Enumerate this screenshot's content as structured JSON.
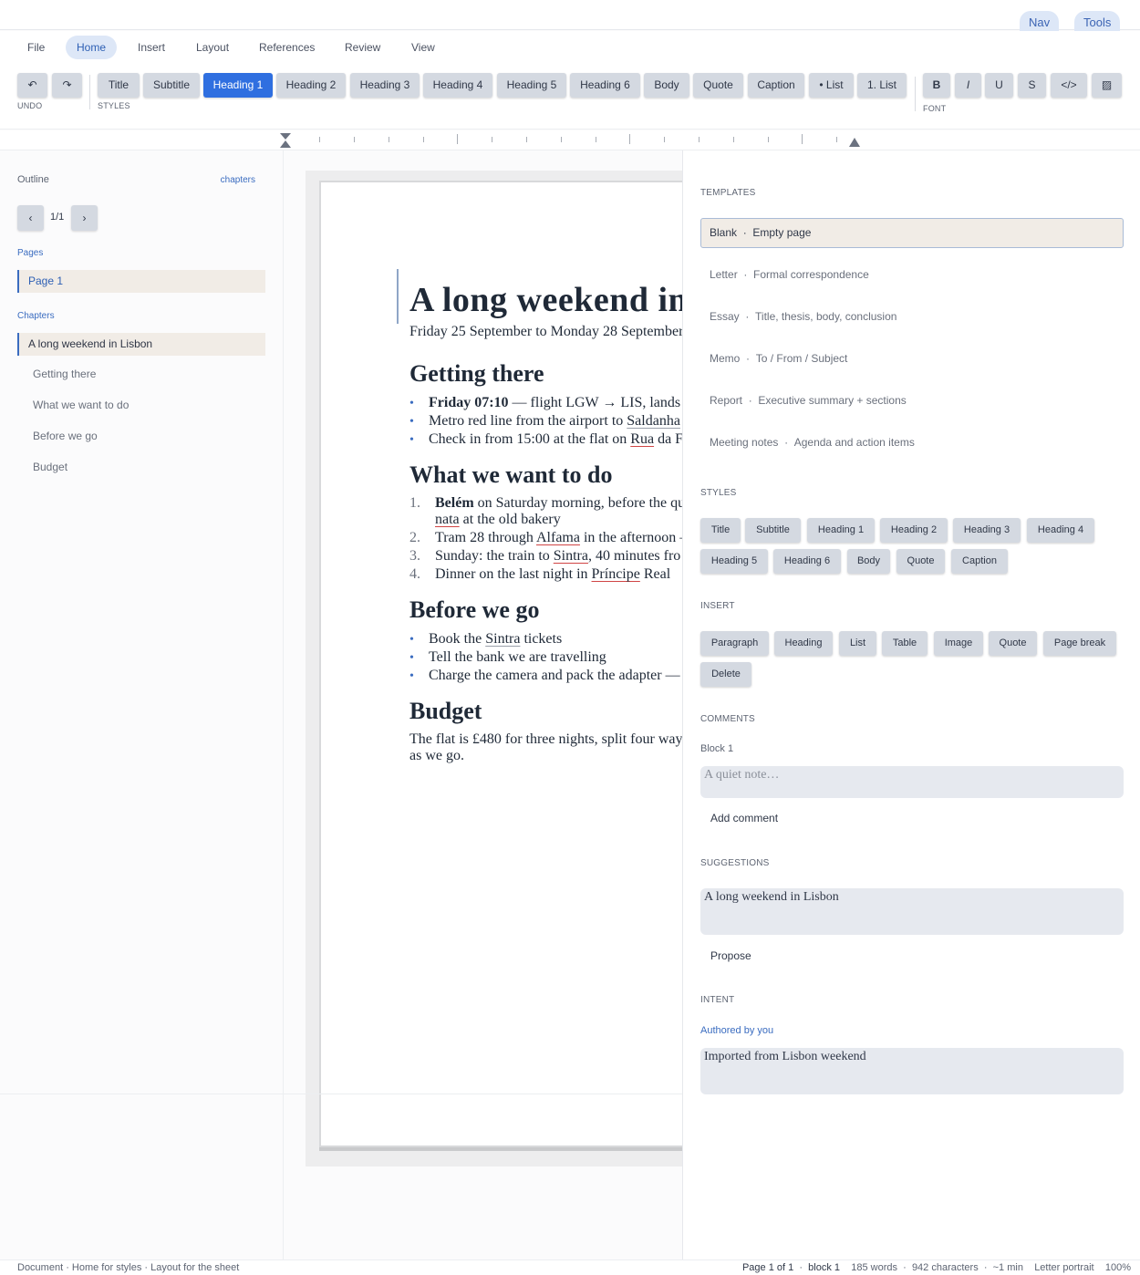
{
  "topbar": {
    "nav_label": "Nav",
    "tools_label": "Tools"
  },
  "menu": {
    "items": [
      "File",
      "Home",
      "Insert",
      "Layout",
      "References",
      "Review",
      "View"
    ],
    "active": "Home"
  },
  "toolbar": {
    "undo_icon": "↶",
    "redo_icon": "↷",
    "undo_group_label": "UNDO",
    "styles_group_label": "STYLES",
    "font_group_label": "FONT",
    "styles": [
      "Title",
      "Subtitle",
      "Heading 1",
      "Heading 2",
      "Heading 3",
      "Heading 4",
      "Heading 5",
      "Heading 6",
      "Body",
      "Quote",
      "Caption",
      "• List",
      "1. List"
    ],
    "active_style": "Heading 1",
    "font_buttons": [
      "B",
      "I",
      "U",
      "S",
      "</>",
      "▨"
    ]
  },
  "sidebar": {
    "title": "Outline",
    "mode_link": "chapters",
    "pager": {
      "prev": "‹",
      "next": "›",
      "label": "1/1"
    },
    "pages_label": "Pages",
    "pages": [
      "Page 1"
    ],
    "chapters_label": "Chapters",
    "chapters": [
      "A long weekend in Lisbon",
      "Getting there",
      "What we want to do",
      "Before we go",
      "Budget"
    ]
  },
  "document": {
    "title": "A long weekend in Lisbon",
    "subtitle": "Friday 25 September to Monday 28 September",
    "sections": {
      "getting_there": {
        "heading": "Getting there",
        "items": [
          {
            "bold": "Friday 07:10",
            "text": " — flight LGW → LIS, lands"
          },
          {
            "text": "Metro red line from the airport to ",
            "link": "Saldanha"
          },
          {
            "text": "Check in from 15:00 at the flat on ",
            "link": "Rua",
            "rest": " da F"
          }
        ]
      },
      "what_we_want": {
        "heading": "What we want to do",
        "items": [
          {
            "num": "1.",
            "bold": "Belém",
            "text": " on Saturday morning, before the qu",
            "cont_link": "nata",
            "cont_text": " at the old bakery"
          },
          {
            "num": "2.",
            "text": "Tram 28 through ",
            "link": "Alfama",
            "rest": " in the afternoon —"
          },
          {
            "num": "3.",
            "text": "Sunday: the train to ",
            "link": "Sintra",
            "rest": ", 40 minutes fro"
          },
          {
            "num": "4.",
            "text": "Dinner on the last night in ",
            "link": "Príncipe",
            "rest": " Real"
          }
        ]
      },
      "before_we_go": {
        "heading": "Before we go",
        "items": [
          {
            "text": "Book the ",
            "link": "Sintra",
            "rest": " tickets"
          },
          {
            "text": "Tell the bank we are travelling"
          },
          {
            "text": "Charge the camera and pack the adapter —"
          }
        ]
      },
      "budget": {
        "heading": "Budget",
        "line1": "The flat is £480 for three nights, split four way",
        "line2": "as we go."
      }
    }
  },
  "panel": {
    "templates_label": "TEMPLATES",
    "templates": [
      {
        "name": "Blank",
        "desc": "Empty page"
      },
      {
        "name": "Letter",
        "desc": "Formal correspondence"
      },
      {
        "name": "Essay",
        "desc": "Title, thesis, body, conclusion"
      },
      {
        "name": "Memo",
        "desc": "To / From / Subject"
      },
      {
        "name": "Report",
        "desc": "Executive summary + sections"
      },
      {
        "name": "Meeting notes",
        "desc": "Agenda and action items"
      }
    ],
    "separator": "·",
    "styles_label": "STYLES",
    "styles": [
      "Title",
      "Subtitle",
      "Heading 1",
      "Heading 2",
      "Heading 3",
      "Heading 4",
      "Heading 5",
      "Heading 6",
      "Body",
      "Quote",
      "Caption"
    ],
    "insert_label": "INSERT",
    "insert": [
      "Paragraph",
      "Heading",
      "List",
      "Table",
      "Image",
      "Quote",
      "Page break",
      "Delete"
    ],
    "comments_label": "COMMENTS",
    "comment_block": "Block 1",
    "comment_placeholder": "A quiet note…",
    "add_comment": "Add comment",
    "suggestions_label": "SUGGESTIONS",
    "suggestion_value": "A long weekend in Lisbon",
    "propose": "Propose",
    "intent_label": "INTENT",
    "intent_author": "Authored by you",
    "intent_value": "Imported from Lisbon weekend"
  },
  "status": {
    "left": "Document · Home for styles · Layout for the sheet",
    "page": "Page 1 of 1",
    "block": "block 1",
    "words": "185 words",
    "chars": "942 characters",
    "read": "~1 min",
    "paper": "Letter portrait",
    "zoom": "100%"
  },
  "colors": {
    "accent": "#2f6fe0",
    "chip": "#d4d9e1",
    "selected_bg": "#f1ece6",
    "link": "#3a6cc0"
  }
}
